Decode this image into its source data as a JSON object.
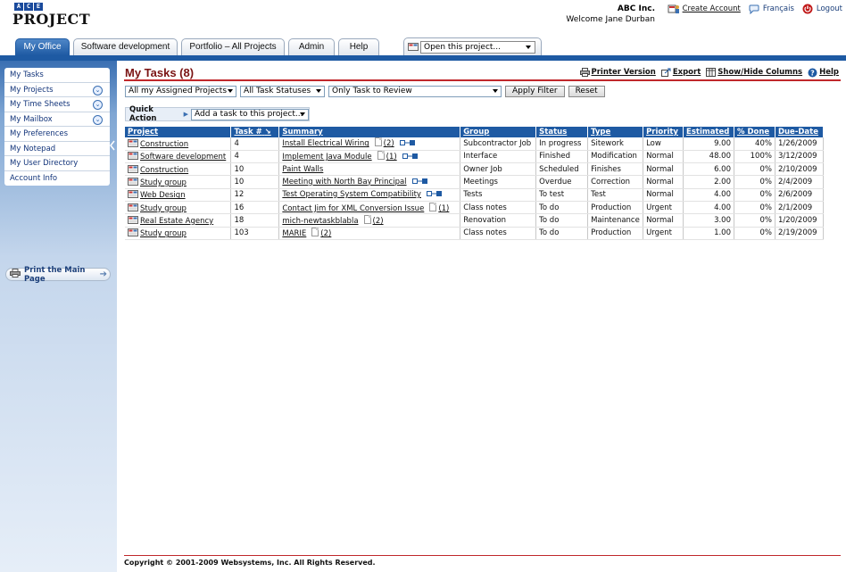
{
  "header": {
    "logo_top": "ACE",
    "logo_main": "PROJECT",
    "company": "ABC Inc.",
    "welcome": "Welcome Jane Durban",
    "links": [
      {
        "label": "Create Account",
        "icon": "create-account-icon"
      },
      {
        "label": "Français",
        "icon": "language-icon"
      },
      {
        "label": "Logout",
        "icon": "logout-icon"
      }
    ]
  },
  "tabs": [
    {
      "label": "My Office",
      "active": true
    },
    {
      "label": "Software development",
      "active": false
    },
    {
      "label": "Portfolio – All Projects",
      "active": false
    },
    {
      "label": "Admin",
      "active": false
    },
    {
      "label": "Help",
      "active": false
    }
  ],
  "open_project": {
    "value": "Open this project..."
  },
  "sidebar": {
    "items": [
      {
        "label": "My Tasks",
        "expandable": false
      },
      {
        "label": "My Projects",
        "expandable": true
      },
      {
        "label": "My Time Sheets",
        "expandable": true
      },
      {
        "label": "My Mailbox",
        "expandable": true
      },
      {
        "label": "My Preferences",
        "expandable": false
      },
      {
        "label": "My Notepad",
        "expandable": false
      },
      {
        "label": "My User Directory",
        "expandable": false
      },
      {
        "label": "Account Info",
        "expandable": false
      }
    ],
    "print_label": "Print the Main Page"
  },
  "main": {
    "title": "My Tasks (8)",
    "actions": [
      {
        "label": "Printer Version",
        "icon": "printer-icon"
      },
      {
        "label": "Export",
        "icon": "export-icon"
      },
      {
        "label": "Show/Hide Columns",
        "icon": "columns-icon"
      },
      {
        "label": "Help",
        "icon": "help-icon"
      }
    ],
    "filters": {
      "projects": "All my Assigned Projects",
      "statuses": "All Task Statuses",
      "review": "Only Task to Review",
      "apply": "Apply Filter",
      "reset": "Reset"
    },
    "quick_action": {
      "label": "Quick Action",
      "value": "Add a task to this project..."
    },
    "columns": [
      "Project",
      "Task #",
      "Summary",
      "Group",
      "Status",
      "Type",
      "Priority",
      "Estimated",
      "% Done",
      "Due-Date"
    ],
    "rows": [
      {
        "project": "Construction",
        "task": "4",
        "summary": "Install Electrical Wiring",
        "docs": "(2)",
        "linked": true,
        "group": "Subcontractor Job",
        "status": "In progress",
        "type": "Sitework",
        "priority": "Low",
        "estimated": "9.00",
        "done": "40%",
        "due": "1/26/2009"
      },
      {
        "project": "Software development",
        "task": "4",
        "summary": "Implement Java Module",
        "docs": "(1)",
        "linked": true,
        "group": "Interface",
        "status": "Finished",
        "type": "Modification",
        "priority": "Normal",
        "estimated": "48.00",
        "done": "100%",
        "due": "3/12/2009"
      },
      {
        "project": "Construction",
        "task": "10",
        "summary": "Paint Walls",
        "docs": "",
        "linked": false,
        "group": "Owner Job",
        "status": "Scheduled",
        "type": "Finishes",
        "priority": "Normal",
        "estimated": "6.00",
        "done": "0%",
        "due": "2/10/2009"
      },
      {
        "project": "Study group",
        "task": "10",
        "summary": "Meeting with North Bay Principal",
        "docs": "",
        "linked": true,
        "group": "Meetings",
        "status": "Overdue",
        "type": "Correction",
        "priority": "Normal",
        "estimated": "2.00",
        "done": "0%",
        "due": "2/4/2009"
      },
      {
        "project": "Web Design",
        "task": "12",
        "summary": "Test Operating System Compatibility",
        "docs": "",
        "linked": true,
        "group": "Tests",
        "status": "To test",
        "type": "Test",
        "priority": "Normal",
        "estimated": "4.00",
        "done": "0%",
        "due": "2/6/2009"
      },
      {
        "project": "Study group",
        "task": "16",
        "summary": "Contact Jim for XML Conversion Issue",
        "docs": "(1)",
        "linked": false,
        "group": "Class notes",
        "status": "To do",
        "type": "Production",
        "priority": "Urgent",
        "estimated": "4.00",
        "done": "0%",
        "due": "2/1/2009"
      },
      {
        "project": "Real Estate Agency",
        "task": "18",
        "summary": "mich-newtaskblabla",
        "docs": "(2)",
        "linked": false,
        "group": "Renovation",
        "status": "To do",
        "type": "Maintenance",
        "priority": "Normal",
        "estimated": "3.00",
        "done": "0%",
        "due": "1/20/2009"
      },
      {
        "project": "Study group",
        "task": "103",
        "summary": "MARIE",
        "docs": "(2)",
        "linked": false,
        "group": "Class notes",
        "status": "To do",
        "type": "Production",
        "priority": "Urgent",
        "estimated": "1.00",
        "done": "0%",
        "due": "2/19/2009"
      }
    ]
  },
  "footer": {
    "copyright": "Copyright © 2001-2009 Websystems, Inc. All Rights Reserved."
  },
  "colors": {
    "primary": "#1e5aa3",
    "title": "#7a1414",
    "rule": "#c0282b"
  }
}
